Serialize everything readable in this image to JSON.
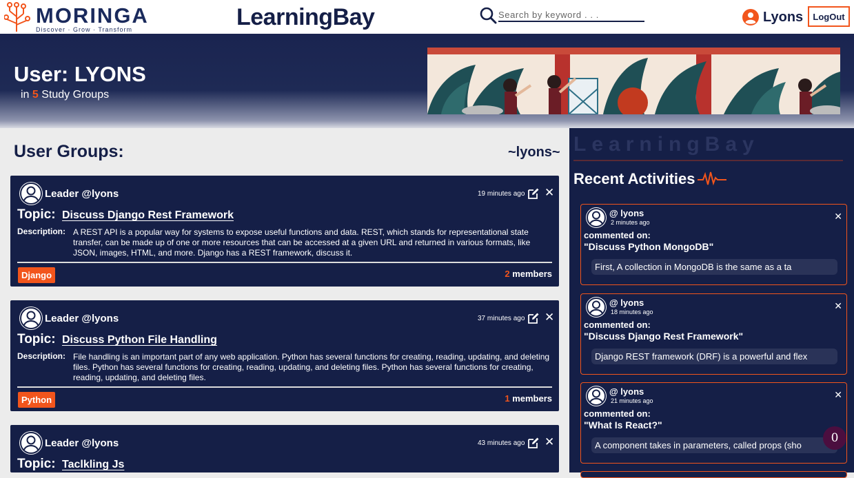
{
  "nav": {
    "logo_text": "MORINGA",
    "logo_tagline": "Discover · Grow · Transform",
    "brand": "LearningBay",
    "search_placeholder": "Search by keyword . . .",
    "username": "Lyons",
    "logout_label": "LogOut"
  },
  "hero": {
    "title": "User: LYONS",
    "sub_prefix": "in",
    "group_count": "5",
    "sub_suffix": "Study Groups"
  },
  "groups": {
    "heading": "User Groups:",
    "handle": "~lyons~",
    "items": [
      {
        "leader": "Leader @lyons",
        "time": "19 minutes ago",
        "topic_label": "Topic:",
        "topic": "Discuss Django Rest Framework",
        "desc_label": "Description:",
        "description": "A REST API is a popular way for systems to expose useful functions and data. REST, which stands for representational state transfer, can be made up of one or more resources that can be accessed at a given URL and returned in various formats, like JSON, images, HTML, and more. Django has a REST framework, discuss it.",
        "tag": "Django",
        "member_count": "2",
        "members_label": "members"
      },
      {
        "leader": "Leader @lyons",
        "time": "37 minutes ago",
        "topic_label": "Topic:",
        "topic": "Discuss Python File Handling",
        "desc_label": "Description:",
        "description": "File handling is an important part of any web application. Python has several functions for creating, reading, updating, and deleting files. Python has several functions for creating, reading, updating, and deleting files. Python has several functions for creating, reading, updating, and deleting files.",
        "tag": "Python",
        "member_count": "1",
        "members_label": "members"
      },
      {
        "leader": "Leader @lyons",
        "time": "43 minutes ago",
        "topic_label": "Topic:",
        "topic": "Taclkling Js"
      }
    ]
  },
  "sidebar": {
    "brand": "LearningBay",
    "title": "Recent Activities",
    "activities": [
      {
        "user": "@ lyons",
        "ago": "2 minutes ago",
        "action": "commented on:",
        "subject": "\"Discuss Python MongoDB\"",
        "message": "First, A collection in MongoDB is the same as a ta"
      },
      {
        "user": "@ lyons",
        "ago": "18 minutes ago",
        "action": "commented on:",
        "subject": "\"Discuss Django Rest Framework\"",
        "message": "Django REST framework (DRF) is a powerful and flex"
      },
      {
        "user": "@ lyons",
        "ago": "21 minutes ago",
        "action": "commented on:",
        "subject": "\"What Is React?\"",
        "message": "A component takes in parameters, called props (sho"
      }
    ]
  },
  "badge_count": "0",
  "colors": {
    "navy": "#151f47",
    "accent": "#f2551c"
  }
}
